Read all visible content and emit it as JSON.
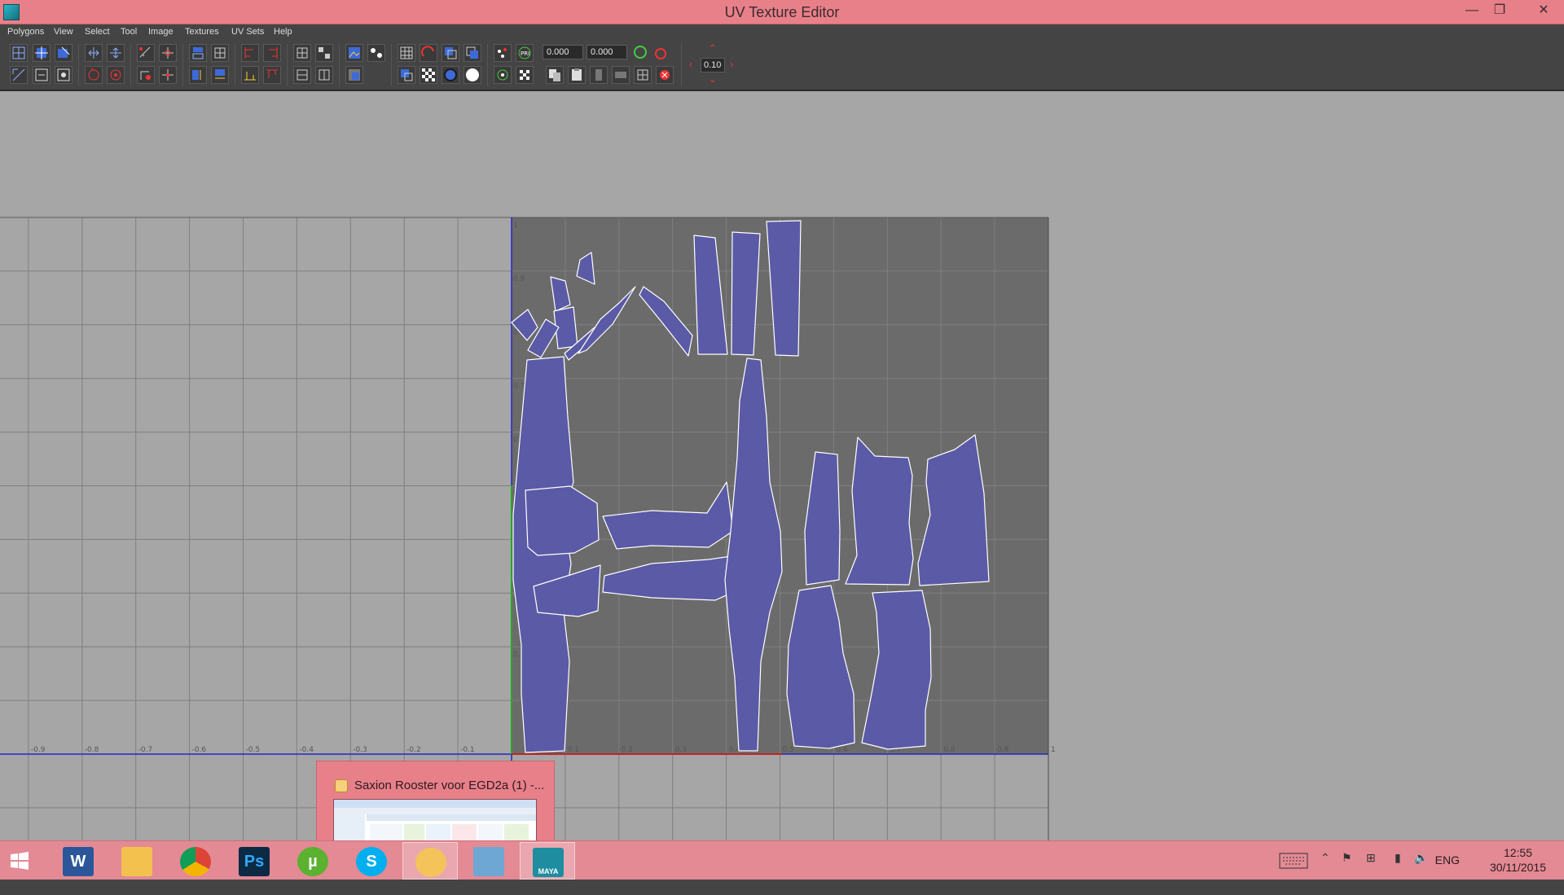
{
  "window": {
    "title": "UV Texture Editor",
    "minimize": "—",
    "restore": "❐",
    "close": "✕"
  },
  "menu": [
    "Polygons",
    "View",
    "Select",
    "Tool",
    "Image",
    "Textures",
    "UV Sets",
    "Help"
  ],
  "toolbar": {
    "u_value": "0.000",
    "v_value": "0.000",
    "step_value": "0.10"
  },
  "axis": {
    "u_labels": [
      "-0.9",
      "-0.8",
      "-0.7",
      "-0.6",
      "-0.5",
      "-0.4",
      "-0.3",
      "-0.2",
      "-0.1",
      "0.1",
      "0.2",
      "0.3",
      "0.4",
      "0.5",
      "0.6",
      "0.7",
      "0.8",
      "0.9",
      "1"
    ],
    "v_labels": [
      "1",
      "0.9",
      "0.8",
      "0.7",
      "0.6",
      "0.5",
      "0.4",
      "0.3",
      "0.2"
    ]
  },
  "preview": {
    "title": "Saxion Rooster voor EGD2a (1) -..."
  },
  "taskbar": {
    "apps": [
      {
        "name": "word",
        "label": "W",
        "color": "#2b579a"
      },
      {
        "name": "explorer",
        "label": "",
        "color": "#f2c14e"
      },
      {
        "name": "chrome",
        "label": "",
        "color": "#4285f4"
      },
      {
        "name": "photoshop",
        "label": "Ps",
        "color": "#0b2a44"
      },
      {
        "name": "utorrent",
        "label": "µ",
        "color": "#5bb130"
      },
      {
        "name": "skype",
        "label": "S",
        "color": "#00aff0"
      },
      {
        "name": "outlook",
        "label": "",
        "color": "#f4c35a"
      },
      {
        "name": "remote-desktop",
        "label": "",
        "color": "#6ea7d3"
      },
      {
        "name": "maya",
        "label": "MAYA",
        "color": "#1e8da0"
      }
    ],
    "language": "ENG",
    "time": "12:55",
    "date": "30/11/2015"
  }
}
